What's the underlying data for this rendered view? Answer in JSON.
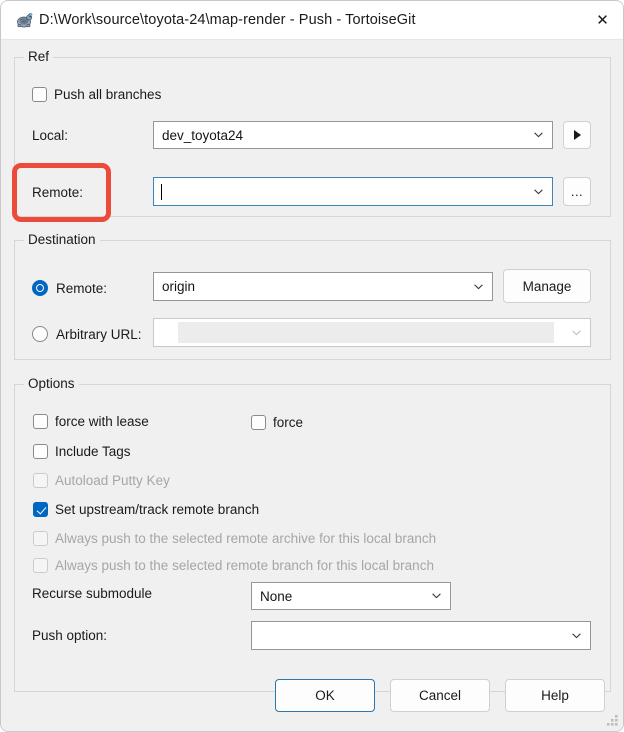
{
  "window": {
    "title": "D:\\Work\\source\\toyota-24\\map-render - Push - TortoiseGit",
    "icon": "tortoisegit-turtle-icon",
    "close_label": "✕"
  },
  "ref_group": {
    "title": "Ref",
    "push_all_branches": {
      "label": "Push all branches",
      "checked": false
    },
    "local": {
      "label": "Local:",
      "value": "dev_toyota24",
      "side_button": "▶"
    },
    "remote": {
      "label": "Remote:",
      "value": "",
      "focused": true,
      "side_button": "..."
    }
  },
  "destination_group": {
    "title": "Destination",
    "remote": {
      "label": "Remote:",
      "selected": true,
      "value": "origin",
      "manage_label": "Manage"
    },
    "arbitrary_url": {
      "label": "Arbitrary URL:",
      "selected": false,
      "value": "",
      "disabled": true
    }
  },
  "options_group": {
    "title": "Options",
    "force_with_lease": {
      "label": "force with lease",
      "checked": false,
      "disabled": false
    },
    "force": {
      "label": "force",
      "checked": false,
      "disabled": false
    },
    "include_tags": {
      "label": "Include Tags",
      "checked": false,
      "disabled": false
    },
    "autoload_putty_key": {
      "label": "Autoload Putty Key",
      "checked": false,
      "disabled": true
    },
    "set_upstream": {
      "label": "Set upstream/track remote branch",
      "checked": true,
      "disabled": false
    },
    "always_push_remote_archive": {
      "label": "Always push to the selected remote archive for this local branch",
      "checked": false,
      "disabled": true
    },
    "always_push_remote_branch": {
      "label": "Always push to the selected remote branch for this local branch",
      "checked": false,
      "disabled": true
    },
    "recurse_submodule": {
      "label": "Recurse submodule",
      "value": "None"
    },
    "push_option": {
      "label": "Push option:",
      "value": ""
    }
  },
  "footer": {
    "ok_label": "OK",
    "cancel_label": "Cancel",
    "help_label": "Help"
  },
  "annotation": {
    "color": "#ec4a3b",
    "target": "remote-label"
  }
}
